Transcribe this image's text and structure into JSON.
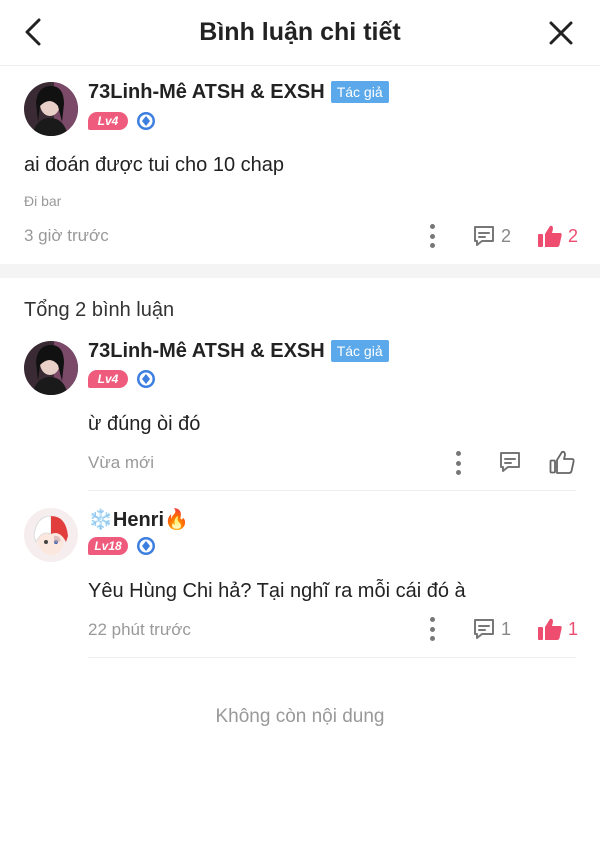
{
  "header": {
    "title": "Bình luận chi tiết",
    "back_icon": "chevron-left-icon",
    "close_icon": "close-icon"
  },
  "main_comment": {
    "username": "73Linh-Mê ATSH & EXSH",
    "author_tag": "Tác giả",
    "level": "Lv4",
    "text": "ai đoán được tui cho 10 chap",
    "source": "Đi bar",
    "time": "3 giờ trước",
    "reply_count": "2",
    "like_count": "2",
    "liked": true
  },
  "total_label": "Tổng 2 bình luận",
  "replies": [
    {
      "username": "73Linh-Mê ATSH & EXSH",
      "author_tag": "Tác giả",
      "level": "Lv4",
      "text": "ừ đúng òi đó",
      "time": "Vừa mới",
      "liked": false
    },
    {
      "username": "❄️Henri🔥",
      "level": "Lv18",
      "text": "Yêu Hùng Chi hả? Tại nghĩ ra mỗi cái đó à",
      "time": "22 phút trước",
      "reply_count": "1",
      "like_count": "1",
      "liked": true
    }
  ],
  "end_text": "Không còn nội dung",
  "colors": {
    "accent_pink": "#ee4d6f",
    "level_badge": "#ee5b7c",
    "author_tag": "#5ba8ea",
    "meta_gray": "#999999"
  }
}
